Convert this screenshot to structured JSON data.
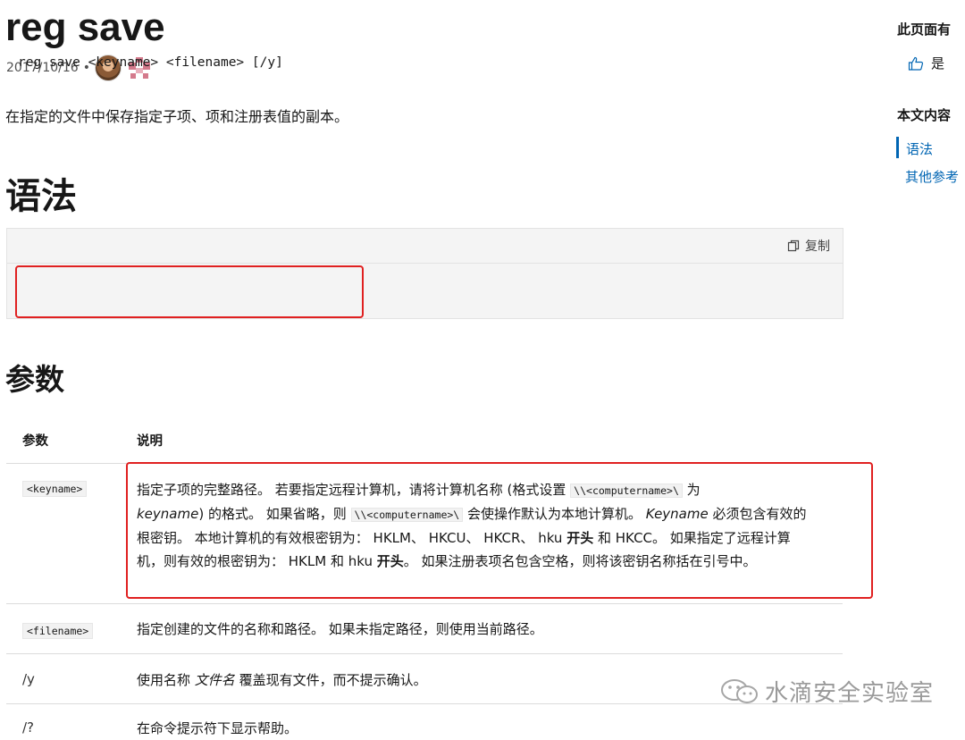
{
  "page": {
    "title": "reg save",
    "date": "2017/10/16",
    "separator": "•",
    "description": "在指定的文件中保存指定子项、项和注册表值的副本。"
  },
  "syntax": {
    "heading": "语法",
    "copy_label": "复制",
    "code": "reg save <keyname> <filename> [/y]"
  },
  "params": {
    "heading": "参数",
    "col_param": "参数",
    "col_desc": "说明",
    "rows": [
      {
        "name": "<keyname>",
        "desc": [
          "指定子项的完整路径。 若要指定远程计算机，请将计算机名称 (格式设置 ",
          "\\\\<computername>\\",
          " 为",
          "keyname",
          ") 的格式。 如果省略，则 ",
          "\\\\<computername>\\",
          " 会使操作默认为本地计算机。 ",
          "Keyname",
          " 必须包含有效的根密钥。 本地计算机的有效根密钥为： HKLM、 HKCU、 HKCR、 hku ",
          "开头",
          " 和 HKCC。 如果指定了远程计算机，则有效的根密钥为： HKLM 和 hku ",
          "开头",
          "。 如果注册表项名包含空格，则将该密钥名称括在引号中。"
        ]
      },
      {
        "name": "<filename>",
        "desc_text": "指定创建的文件的名称和路径。 如果未指定路径，则使用当前路径。"
      },
      {
        "name": "/y",
        "desc": [
          "使用名称 ",
          "文件名",
          " 覆盖现有文件，而不提示确认。"
        ]
      },
      {
        "name": "/?",
        "desc_text": "在命令提示符下显示帮助。"
      }
    ]
  },
  "right_rail": {
    "feedback_heading": "此页面有",
    "yes_label": "是",
    "toc_heading": "本文内容",
    "toc_items": [
      "语法",
      "其他参考"
    ]
  },
  "watermark": "水滴安全实验室",
  "icons": {
    "thumb": "thumbs-up-icon",
    "copy": "copy-icon",
    "wechat": "wechat-icon"
  },
  "colors": {
    "accent": "#0065b3",
    "highlight": "#e02020"
  }
}
